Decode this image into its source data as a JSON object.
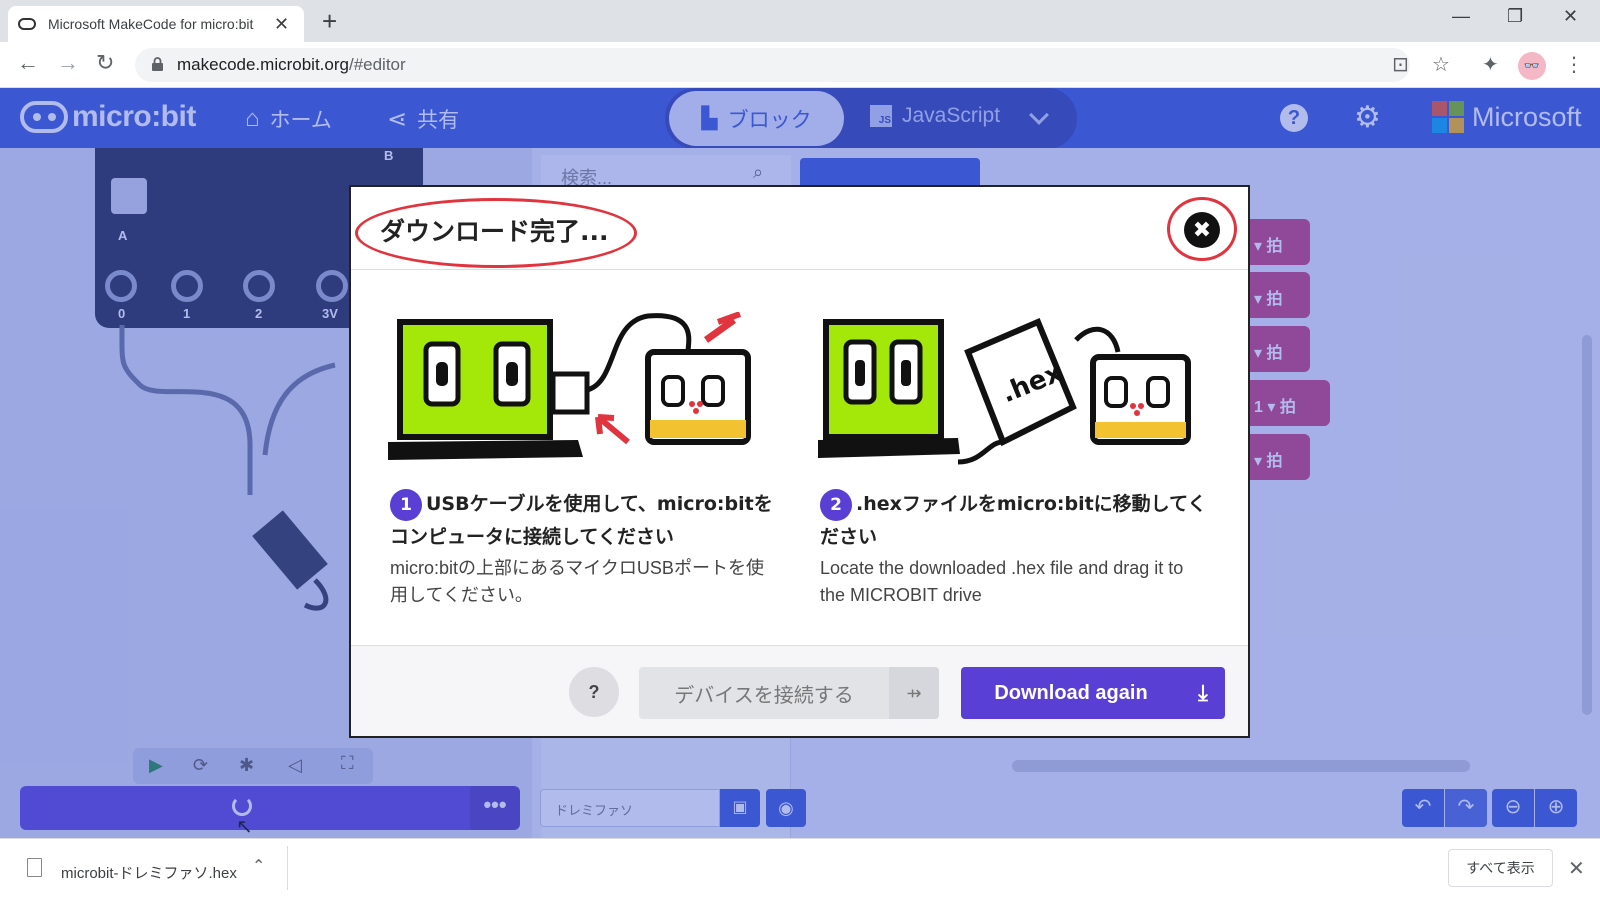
{
  "browser": {
    "tab_title": "Microsoft MakeCode for micro:bit",
    "new_tab": "+",
    "close_tab": "✕",
    "url_host": "makecode.microbit.org",
    "url_path": "/#editor",
    "window_controls": [
      "—",
      "❐",
      "✕"
    ]
  },
  "header": {
    "logo_text": "micro:bit",
    "home_label": "ホーム",
    "share_label": "共有",
    "blocks_tab": "ブロック",
    "js_tab": "JavaScript",
    "js_icon_text": "JS",
    "help_label": "?",
    "brand": "Microsoft",
    "brand_colors": [
      "#f25022",
      "#7fba00",
      "#00a4ef",
      "#ffb900"
    ]
  },
  "editor": {
    "search_placeholder": "検索...",
    "pin_labels": [
      "0",
      "1",
      "2",
      "3V"
    ],
    "button_a": "A",
    "button_b": "B",
    "block_label": "拍",
    "block_number": "1",
    "project_name": "ドレミファソ",
    "more_label": "•••"
  },
  "dialog": {
    "title": "ダウンロード完了...",
    "close_symbol": "✖",
    "step1": {
      "number": "1",
      "heading": "USBケーブルを使用して、micro:bitをコンピュータに接続してください",
      "description": "micro:bitの上部にあるマイクロUSBポートを使用してください。"
    },
    "step2": {
      "number": "2",
      "heading": ".hexファイルをmicro:bitに移動してください",
      "description": "Locate the downloaded .hex file and drag it to the MICROBIT drive"
    },
    "help_label": "?",
    "pair_label": "デバイスを接続する",
    "download_again_label": "Download again",
    "accent_color": "#5a3fd4",
    "annotation_color": "#e0343f"
  },
  "shelf": {
    "filename": "microbit-ドレミファソ.hex",
    "show_all": "すべて表示",
    "close": "✕"
  }
}
